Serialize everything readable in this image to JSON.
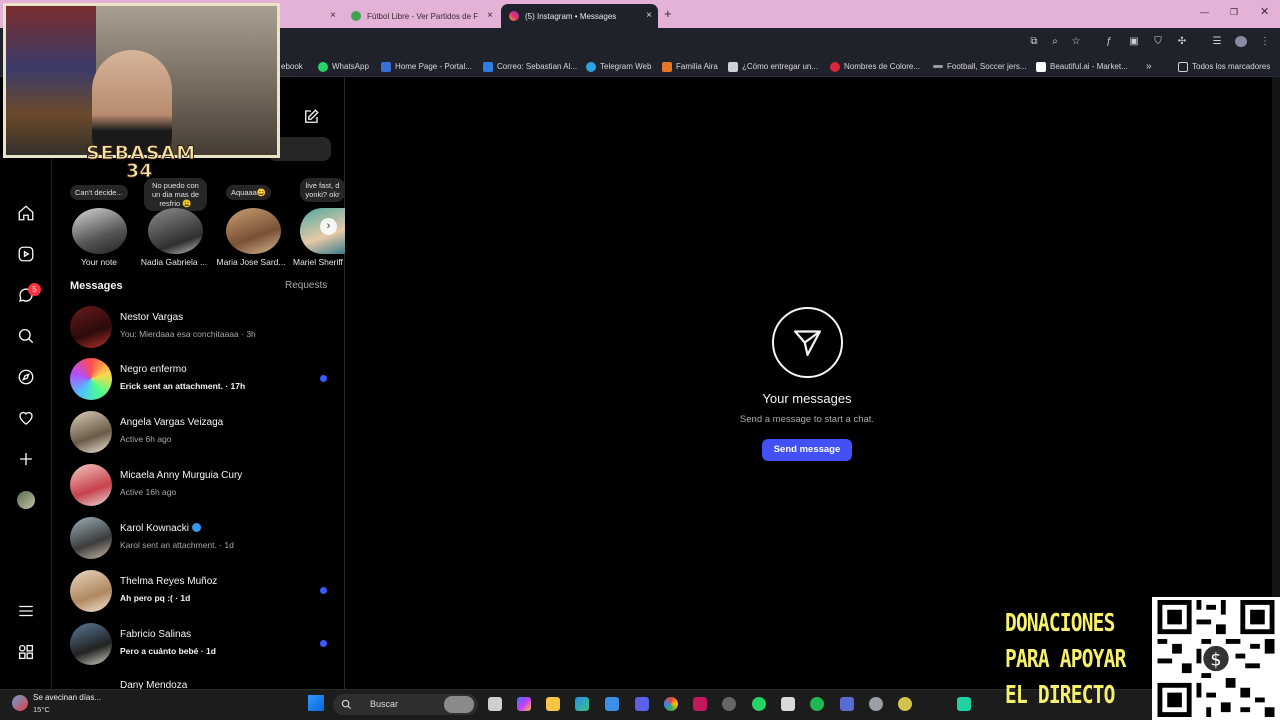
{
  "browser": {
    "tabs": [
      {
        "label": "Fútbol Libre - Ver Partidos de F",
        "close": "×"
      },
      {
        "label": "(5) Instagram • Messages",
        "close": "×"
      }
    ],
    "bookmarks": [
      "ebook",
      "WhatsApp",
      "Home Page - Portal...",
      "Correo: Sebastian Al...",
      "Telegram Web",
      "Familia Aira",
      "¿Cómo entregar un...",
      "Nombres de Colore...",
      "Football, Soccer jers...",
      "Beautiful.ai - Market...",
      "Todos los marcadores"
    ]
  },
  "nav": {
    "notification_count": "5"
  },
  "notes": [
    {
      "bubble": "Can't decide...",
      "name": "Your note"
    },
    {
      "bubble": "No puedo con un dia mas de resfrio 😩",
      "name": "Nadia Gabriela ..."
    },
    {
      "bubble": "Aquaaa😄",
      "name": "Maria Jose Sard..."
    },
    {
      "bubble": "live fast, d yonki? okr",
      "name": "Mariel Sheriff"
    }
  ],
  "messages": {
    "title": "Messages",
    "requests": "Requests",
    "conversations": [
      {
        "name": "Nestor Vargas",
        "preview": "You: Mierdaaa esa conchitaaaa · 3h",
        "unread": false
      },
      {
        "name": "Negro enfermo",
        "preview": "Erick sent an attachment. · 17h",
        "unread": true
      },
      {
        "name": "Angela Vargas Veizaga",
        "preview": "Active 6h ago",
        "unread": false
      },
      {
        "name": "Micaela Anny Murguia Cury",
        "preview": "Active 16h ago",
        "unread": false
      },
      {
        "name": "Karol Kownacki",
        "preview": "Karol sent an attachment. · 1d",
        "unread": false
      },
      {
        "name": "Thelma Reyes Muñoz",
        "preview": "Ah pero pq :( · 1d",
        "unread": true
      },
      {
        "name": "Fabricio Salinas",
        "preview": "Pero a cuánto bebé · 1d",
        "unread": true
      },
      {
        "name": "Dany Mendoza",
        "preview": "",
        "unread": false
      }
    ]
  },
  "main": {
    "heading": "Your messages",
    "subtitle": "Send a message to start a chat.",
    "button": "Send message"
  },
  "taskbar": {
    "weather_text": "Se avecinan días...",
    "temperature": "15°C",
    "search_placeholder": "Buscar"
  },
  "overlay": {
    "streamer_line1": "SEBASAM",
    "streamer_line2": "34",
    "donation_lines": [
      "DONACIONES",
      "PARA APOYAR",
      "EL DIRECTO"
    ]
  },
  "colors": {
    "accent": "#4150f7",
    "unread_dot": "#3b5bff",
    "badge": "#ff3040",
    "tabbar": "#e3b2d6"
  }
}
